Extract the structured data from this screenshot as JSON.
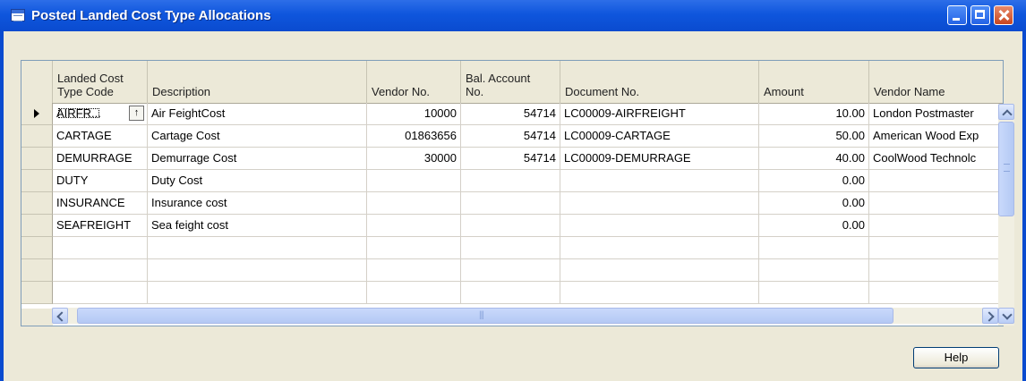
{
  "window": {
    "title": "Posted Landed Cost Type Allocations",
    "icon": "table-form-icon"
  },
  "columns": [
    {
      "label": "Landed Cost\nType Code"
    },
    {
      "label": "Description"
    },
    {
      "label": "Vendor No."
    },
    {
      "label": "Bal. Account\nNo."
    },
    {
      "label": "Document No."
    },
    {
      "label": "Amount"
    },
    {
      "label": "Vendor Name"
    }
  ],
  "rows": [
    {
      "code": "AIRFR...",
      "description": "Air FeightCost",
      "vendor_no": "10000",
      "bal_account_no": "54714",
      "document_no": "LC00009-AIRFREIGHT",
      "amount": "10.00",
      "vendor_name": "London Postmaster",
      "current": true
    },
    {
      "code": "CARTAGE",
      "description": "Cartage Cost",
      "vendor_no": "01863656",
      "bal_account_no": "54714",
      "document_no": "LC00009-CARTAGE",
      "amount": "50.00",
      "vendor_name": "American Wood Exp"
    },
    {
      "code": "DEMURRAGE",
      "description": "Demurrage Cost",
      "vendor_no": "30000",
      "bal_account_no": "54714",
      "document_no": "LC00009-DEMURRAGE",
      "amount": "40.00",
      "vendor_name": "CoolWood Technolc"
    },
    {
      "code": "DUTY",
      "description": "Duty Cost",
      "vendor_no": "",
      "bal_account_no": "",
      "document_no": "",
      "amount": "0.00",
      "vendor_name": ""
    },
    {
      "code": "INSURANCE",
      "description": "Insurance cost",
      "vendor_no": "",
      "bal_account_no": "",
      "document_no": "",
      "amount": "0.00",
      "vendor_name": ""
    },
    {
      "code": "SEAFREIGHT",
      "description": "Sea feight cost",
      "vendor_no": "",
      "bal_account_no": "",
      "document_no": "",
      "amount": "0.00",
      "vendor_name": ""
    },
    {
      "code": "",
      "description": "",
      "vendor_no": "",
      "bal_account_no": "",
      "document_no": "",
      "amount": "",
      "vendor_name": ""
    },
    {
      "code": "",
      "description": "",
      "vendor_no": "",
      "bal_account_no": "",
      "document_no": "",
      "amount": "",
      "vendor_name": ""
    },
    {
      "code": "",
      "description": "",
      "vendor_no": "",
      "bal_account_no": "",
      "document_no": "",
      "amount": "",
      "vendor_name": ""
    }
  ],
  "buttons": {
    "help": "Help"
  },
  "colors": {
    "titlebar": "#0f56dd",
    "window_bg": "#ece9d8"
  }
}
